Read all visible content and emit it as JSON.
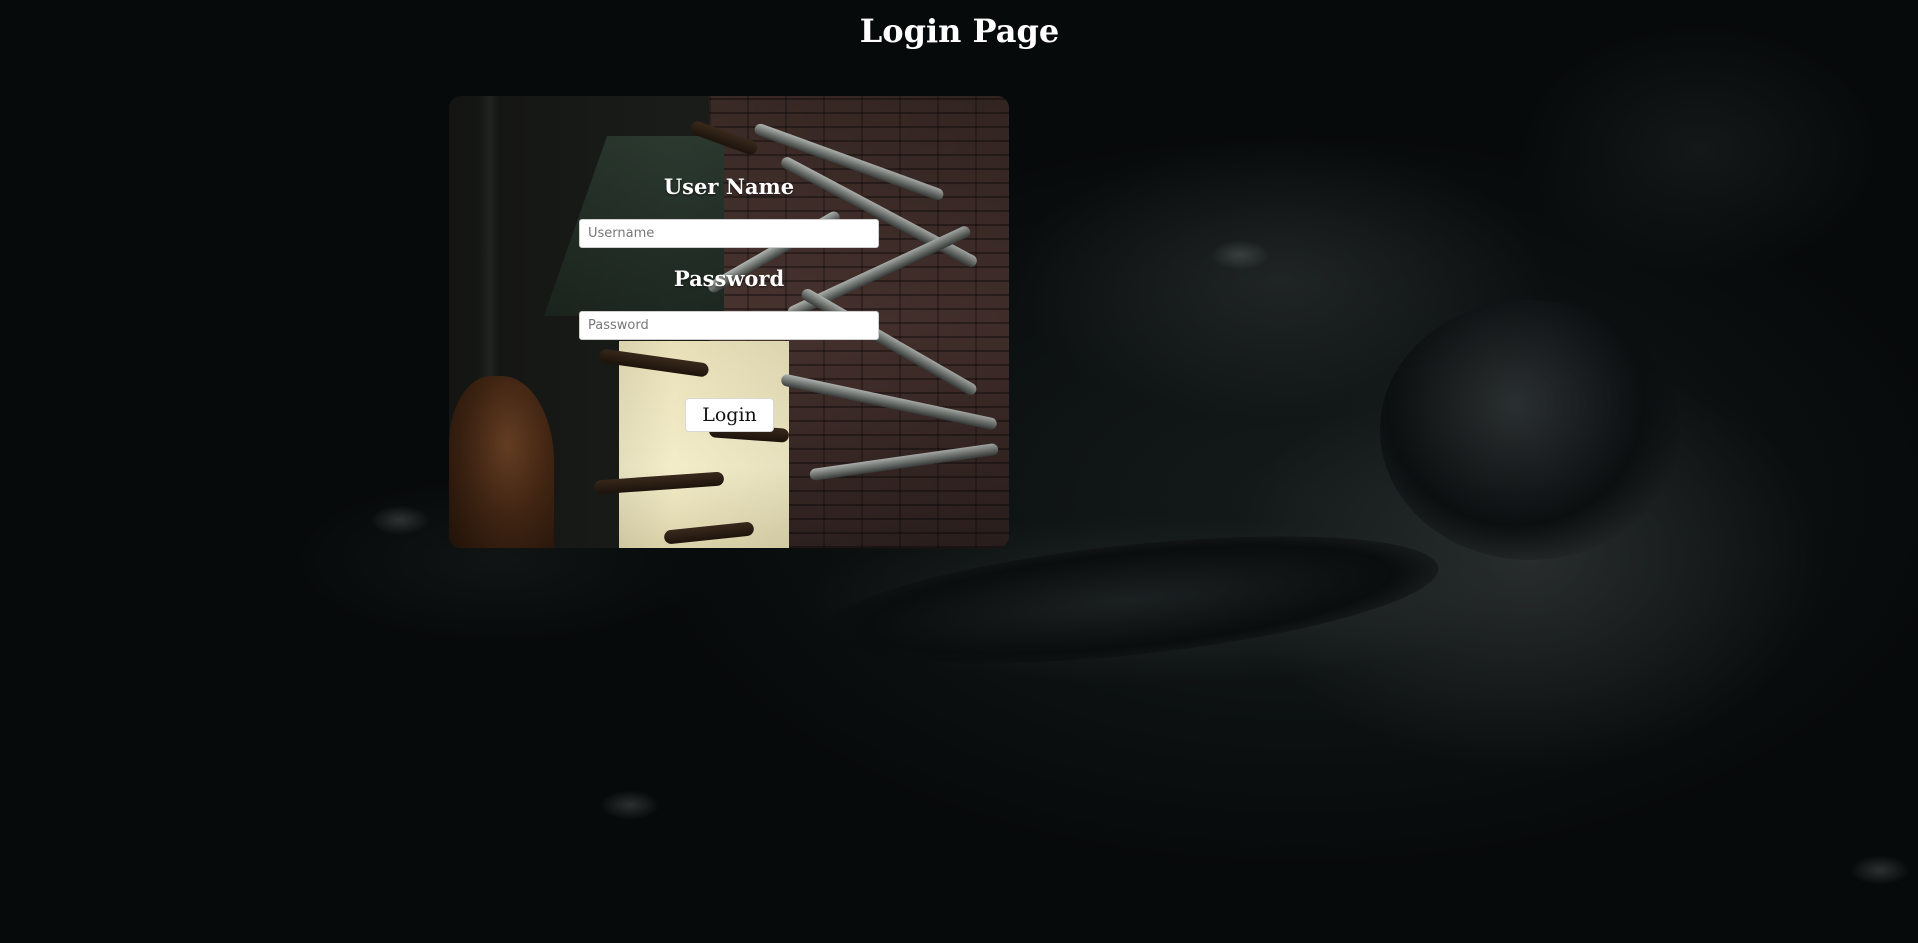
{
  "page": {
    "title": "Login Page"
  },
  "form": {
    "username_label": "User Name",
    "username_placeholder": "Username",
    "username_value": "",
    "password_label": "Password",
    "password_placeholder": "Password",
    "password_value": "",
    "submit_label": "Login"
  },
  "colors": {
    "page_background": "#070a0a",
    "title_text": "#ffffff",
    "label_text": "#ffffff",
    "input_background": "#ffffff",
    "button_background": "#ffffff"
  }
}
